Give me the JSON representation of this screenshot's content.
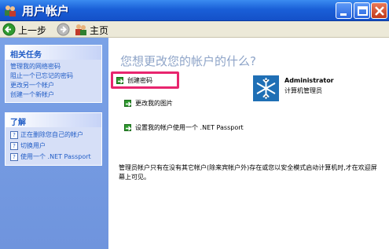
{
  "window": {
    "title": "用户帐户"
  },
  "toolbar": {
    "back_label": "上一步",
    "home_label": "主页"
  },
  "sidebar": {
    "related_tasks": {
      "title": "相关任务",
      "items": [
        "管理我的网络密码",
        "阻止一个已忘记的密码",
        "更改另一个帐户",
        "创建一个新帐户"
      ]
    },
    "learn": {
      "title": "了解",
      "items": [
        "正在删除您自己的帐户",
        "切换用户",
        "使用一个 .NET Passport"
      ]
    }
  },
  "main": {
    "heading": "您想更改您的帐户的什么?",
    "actions": [
      "创建密码",
      "更改我的图片",
      "设置我的帐户使用一个 .NET Passport"
    ],
    "user": {
      "name": "Administrator",
      "role": "计算机管理员"
    },
    "note": "管理员帐户只有在没有其它帐户(除来宾帐户外)存在或您以安全模式启动计算机时,才在欢迎屏幕上可见。"
  },
  "colors": {
    "titlebar": "#1a5fd8",
    "sidebar": "#7ba2e7",
    "link": "#215dc6",
    "heading": "#8ea4c8",
    "highlight": "#e8256e",
    "action_arrow": "#2e9a2e"
  }
}
